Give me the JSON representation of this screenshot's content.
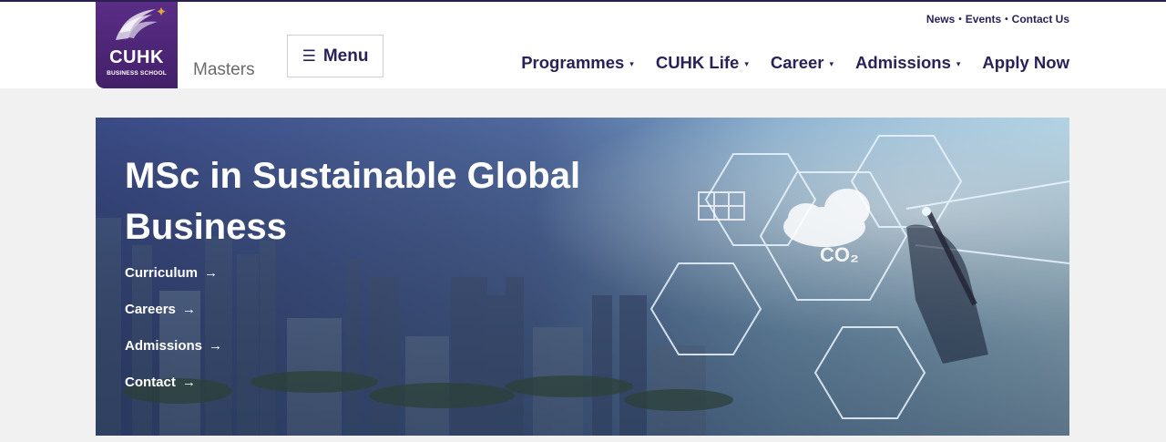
{
  "brand": {
    "name": "CUHK",
    "sub": "BUSINESS SCHOOL",
    "section": "Masters",
    "colors": {
      "purple": "#4d2678",
      "navy": "#2b2158",
      "accent": "#e2a53a"
    }
  },
  "menu": {
    "label": "Menu",
    "icon": "hamburger-icon"
  },
  "utility": {
    "items": [
      "News",
      "Events",
      "Contact Us"
    ],
    "separator": "•"
  },
  "nav": {
    "items": [
      {
        "label": "Programmes",
        "dropdown": true
      },
      {
        "label": "CUHK Life",
        "dropdown": true
      },
      {
        "label": "Career",
        "dropdown": true
      },
      {
        "label": "Admissions",
        "dropdown": true
      },
      {
        "label": "Apply Now",
        "dropdown": false
      }
    ],
    "caret": "▾"
  },
  "hero": {
    "title": "MSc in Sustainable Global Business",
    "links": [
      {
        "label": "Curriculum"
      },
      {
        "label": "Careers"
      },
      {
        "label": "Admissions"
      },
      {
        "label": "Contact"
      }
    ],
    "arrow": "→",
    "cloud_label": "CO₂"
  }
}
